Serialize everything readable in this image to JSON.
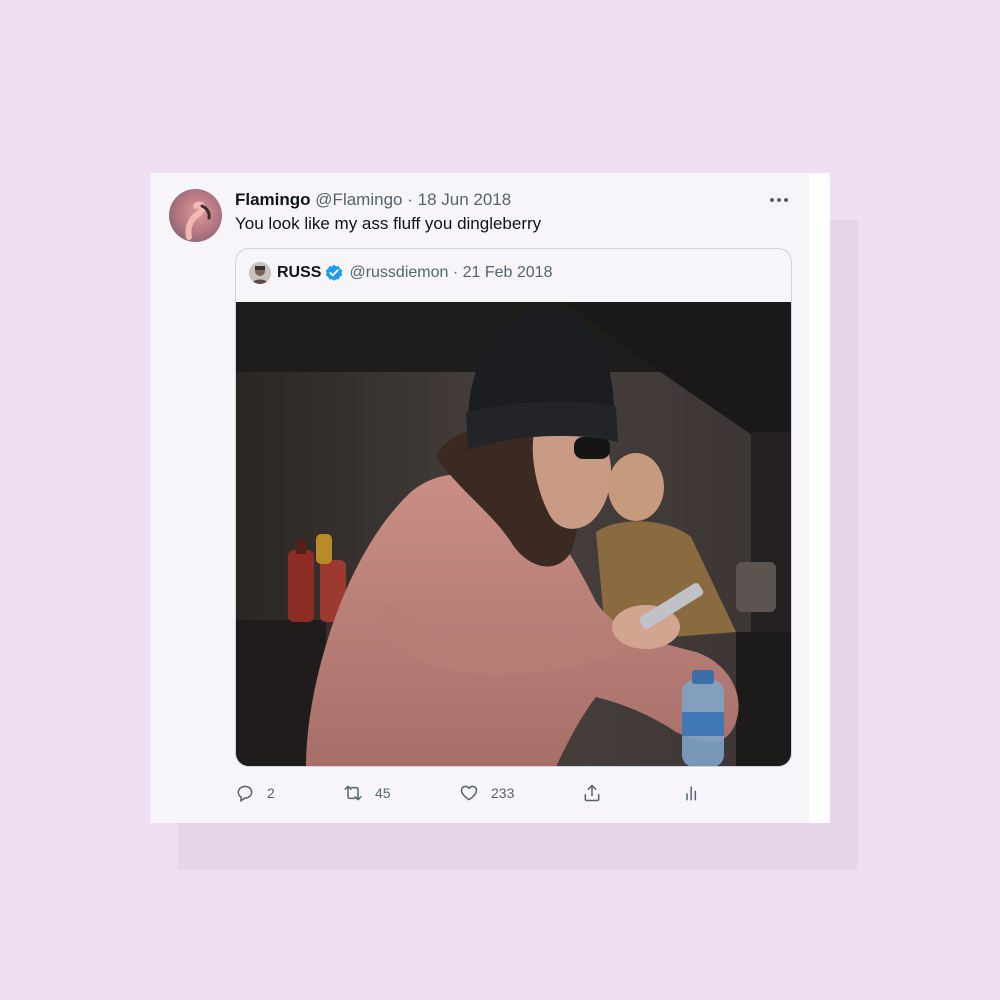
{
  "tweet": {
    "display_name": "Flamingo",
    "handle": "@Flamingo",
    "date": "18 Jun 2018",
    "text": "You look like my ass fluff you dingleberry",
    "more_icon": "more-icon"
  },
  "quoted_tweet": {
    "display_name": "RUSS",
    "verified": true,
    "handle": "@russdiemon",
    "date": "21 Feb 2018",
    "media_description": "photo"
  },
  "actions": {
    "replies": "2",
    "retweets": "45",
    "likes": "233"
  },
  "colors": {
    "background": "#efdff0",
    "card": "#f7f5f9",
    "verified": "#1d9bf0",
    "text_secondary": "#536471"
  }
}
